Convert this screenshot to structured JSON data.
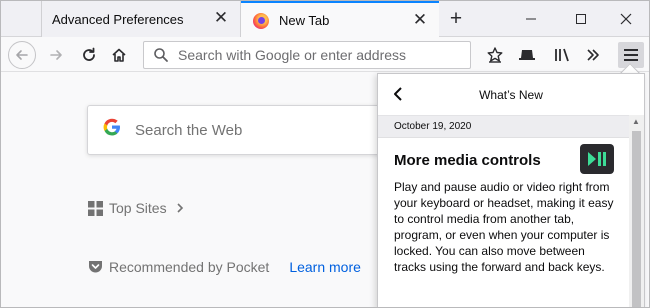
{
  "tabs": [
    {
      "label": "Advanced Preferences",
      "active": false
    },
    {
      "label": "New Tab",
      "active": true
    }
  ],
  "icons": {
    "close": "close-icon",
    "new_tab": "plus-icon",
    "minimize": "minimize-icon",
    "maximize": "maximize-icon",
    "window_close": "close-icon",
    "back": "arrow-left-icon",
    "forward": "arrow-right-icon",
    "reload": "reload-icon",
    "home": "home-icon",
    "search": "search-icon",
    "bookmark": "star-icon",
    "reader": "reader-icon",
    "library": "library-icon",
    "overflow": "chevron-double-icon",
    "menu": "hamburger-icon"
  },
  "urlbar": {
    "placeholder": "Search with Google or enter address"
  },
  "newtab": {
    "search_placeholder": "Search the Web",
    "top_sites": "Top Sites",
    "pocket": "Recommended by Pocket",
    "learn_more": "Learn more"
  },
  "whats_new": {
    "title": "What’s New",
    "date": "October 19, 2020",
    "headline": "More media controls",
    "body": "Play and pause audio or video right from your keyboard or headset, making it easy to control media from another tab, program, or even when your computer is locked. You can also move between tracks using the forward and back keys."
  },
  "colors": {
    "accent": "#0a84ff",
    "link": "#0060df",
    "media_icon_bg": "#2a2a2e",
    "media_icon_fg": "#3ddc97"
  }
}
